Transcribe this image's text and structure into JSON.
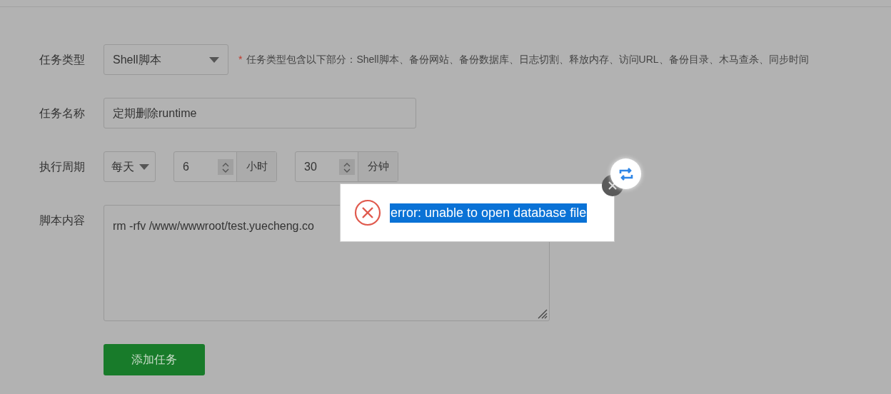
{
  "form": {
    "fields": [
      {
        "kind": "select",
        "label": "任务类型",
        "value": "Shell脚本",
        "hint_mark": "*",
        "hint": "任务类型包含以下部分：Shell脚本、备份网站、备份数据库、日志切割、释放内存、访问URL、备份目录、木马查杀、同步时间"
      },
      {
        "kind": "text",
        "label": "任务名称",
        "value": "定期删除runtime"
      },
      {
        "kind": "period",
        "label": "执行周期",
        "period": "每天",
        "hour": "6",
        "hour_unit": "小时",
        "minute": "30",
        "minute_unit": "分钟"
      },
      {
        "kind": "textarea",
        "label": "脚本内容",
        "value": "rm -rfv /www/wwwroot/test.yuecheng.co"
      }
    ],
    "submit": "添加任务"
  },
  "dialog": {
    "message": "error: unable to open database file",
    "highlighted": true
  }
}
